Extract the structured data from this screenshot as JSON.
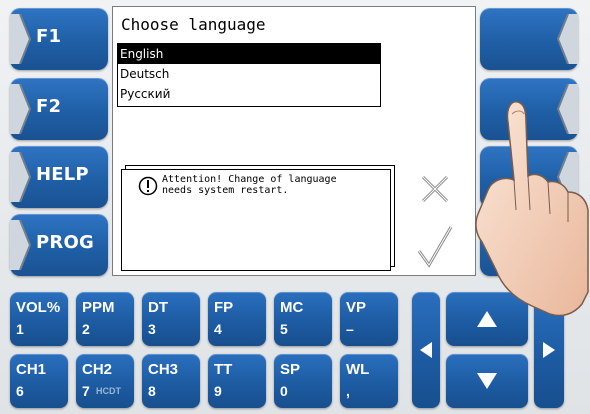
{
  "softkeys": {
    "left": [
      "F1",
      "F2",
      "HELP",
      "PROG"
    ]
  },
  "screen": {
    "title": "Choose language",
    "languages": [
      "English",
      "Deutsch",
      "Русский"
    ],
    "selected_language": "English",
    "message": "Attention! Change of language\nneeds system restart."
  },
  "keypad": {
    "row1": [
      {
        "top": "VOL%",
        "bottom": "1"
      },
      {
        "top": "PPM",
        "bottom": "2"
      },
      {
        "top": "DT",
        "bottom": "3"
      },
      {
        "top": "FP",
        "bottom": "4"
      },
      {
        "top": "MC",
        "bottom": "5"
      },
      {
        "top": "VP",
        "bottom": "–"
      }
    ],
    "row2": [
      {
        "top": "CH1",
        "bottom": "6"
      },
      {
        "top": "CH2",
        "bottom": "7",
        "extra": "HCDT"
      },
      {
        "top": "CH3",
        "bottom": "8"
      },
      {
        "top": "TT",
        "bottom": "9"
      },
      {
        "top": "SP",
        "bottom": "0"
      },
      {
        "top": "WL",
        "bottom": ","
      }
    ]
  },
  "colors": {
    "key_blue": "#1f5fa6",
    "screen_bg": "#ffffff"
  }
}
